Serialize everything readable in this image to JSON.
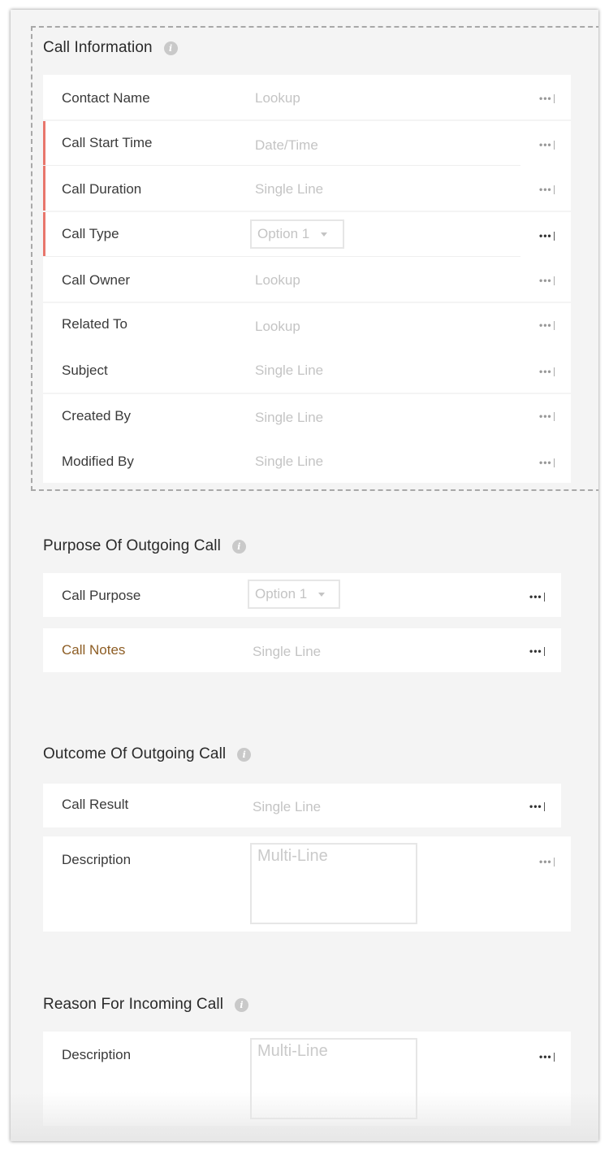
{
  "sections": {
    "call_information": {
      "title": "Call Information",
      "rows": [
        {
          "label": "Contact Name",
          "type": "Lookup"
        },
        {
          "label": "Call Start Time",
          "type": "Date/Time"
        },
        {
          "label": "Call Duration",
          "type": "Single Line"
        },
        {
          "label": "Call Type",
          "type": "Option 1"
        },
        {
          "label": "Call Owner",
          "type": "Lookup"
        },
        {
          "label": "Related To",
          "type": "Lookup"
        },
        {
          "label": "Subject",
          "type": "Single Line"
        },
        {
          "label": "Created By",
          "type": "Single Line"
        },
        {
          "label": "Modified By",
          "type": "Single Line"
        }
      ]
    },
    "purpose_outgoing": {
      "title": "Purpose Of Outgoing Call",
      "rows": [
        {
          "label": "Call Purpose",
          "type": "Option 1"
        },
        {
          "label": "Call Notes",
          "type": "Single Line"
        }
      ]
    },
    "outcome_outgoing": {
      "title": "Outcome Of Outgoing Call",
      "rows": [
        {
          "label": "Call Result",
          "type": "Single Line"
        },
        {
          "label": "Description",
          "type": "Multi-Line"
        }
      ]
    },
    "reason_incoming": {
      "title": "Reason For Incoming Call",
      "rows": [
        {
          "label": "Description",
          "type": "Multi-Line"
        }
      ]
    }
  },
  "icons": {
    "info": "info-icon",
    "more": "more-options-icon",
    "dropdown": "chevron-down-icon"
  },
  "colors": {
    "mandatory_marker": "#e8766c",
    "highlight_label": "#8d5d24",
    "background": "#f4f4f4"
  }
}
